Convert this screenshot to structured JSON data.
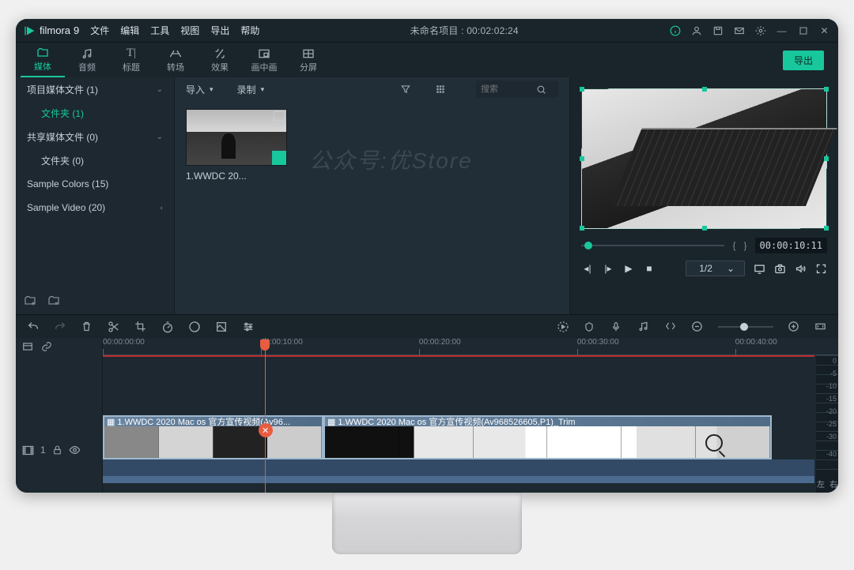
{
  "app": {
    "name": "filmora",
    "version": "9"
  },
  "menu": [
    "文件",
    "编辑",
    "工具",
    "视图",
    "导出",
    "帮助"
  ],
  "project": {
    "title_prefix": "未命名项目",
    "time": "00:02:02:24"
  },
  "export_label": "导出",
  "tools": [
    {
      "id": "media",
      "label": "媒体"
    },
    {
      "id": "audio",
      "label": "音频"
    },
    {
      "id": "title",
      "label": "标题"
    },
    {
      "id": "transition",
      "label": "转场"
    },
    {
      "id": "effect",
      "label": "效果"
    },
    {
      "id": "pip",
      "label": "画中画"
    },
    {
      "id": "split",
      "label": "分屏"
    }
  ],
  "sidebar": {
    "items": [
      {
        "label": "项目媒体文件 (1)",
        "expandable": true
      },
      {
        "label": "文件夹 (1)",
        "child": true,
        "accent": true
      },
      {
        "label": "共享媒体文件 (0)",
        "expandable": true
      },
      {
        "label": "文件夹 (0)",
        "child": true
      },
      {
        "label": "Sample Colors (15)"
      },
      {
        "label": "Sample Video (20)"
      }
    ]
  },
  "browser": {
    "import": "导入",
    "record": "录制",
    "search_placeholder": "搜索",
    "clip_name": "1.WWDC 20...",
    "watermark": "公众号:优Store"
  },
  "preview": {
    "timecode": "00:00:10:11",
    "rate": "1/2",
    "in_brace": "{",
    "out_brace": "}"
  },
  "timeline": {
    "ruler": [
      "00:00:00:00",
      "00:00:10:00",
      "00:00:20:00",
      "00:00:30:00",
      "00:00:40:00"
    ],
    "track_label": "1",
    "clip1_name": "1.WWDC 2020 Mac os 官方宣传视频(Av96...",
    "clip2_name": "1.WWDC 2020 Mac os 官方宣传视频(Av968526605,P1)_Trim",
    "meter_left": "左",
    "meter_right": "右",
    "db_marks": [
      "0",
      "-5",
      "-10",
      "-15",
      "-20",
      "-25",
      "-30",
      "-40"
    ]
  }
}
